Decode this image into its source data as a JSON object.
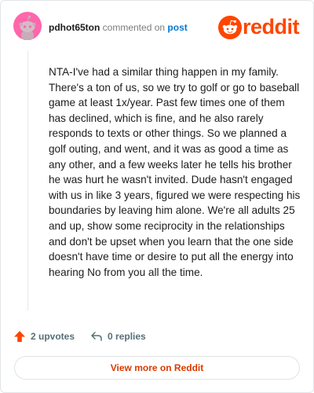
{
  "comment": {
    "username": "pdhot65ton",
    "commented_on_text": "commented on",
    "post_link_text": "post",
    "body": "NTA-I've had a similar thing happen in my family. There's a ton of us, so we try to golf or go to baseball game at least 1x/year. Past few times one of them has declined, which is fine, and he also rarely responds to texts or other things. So we planned a golf outing, and went, and it was as good a time as any other, and a few weeks later he tells his brother he was hurt he wasn't invited. Dude hasn't engaged with us in like 3 years, figured we were respecting his boundaries by leaving him alone. We're all adults 25 and up, show some reciprocity in the relationships and don't be upset when you learn that the one side doesn't have time or desire to put all the energy into hearing No from you all the time."
  },
  "brand": {
    "name": "reddit",
    "color": "#ff4500",
    "icon": "reddit-snoo-icon"
  },
  "actions": {
    "upvotes_label": "2 upvotes",
    "replies_label": "0 replies"
  },
  "footer": {
    "view_more_label": "View more on Reddit"
  },
  "colors": {
    "accent": "#ff4500",
    "link": "#0079d3",
    "view_more_text": "#d93a00",
    "muted": "#576f76"
  }
}
